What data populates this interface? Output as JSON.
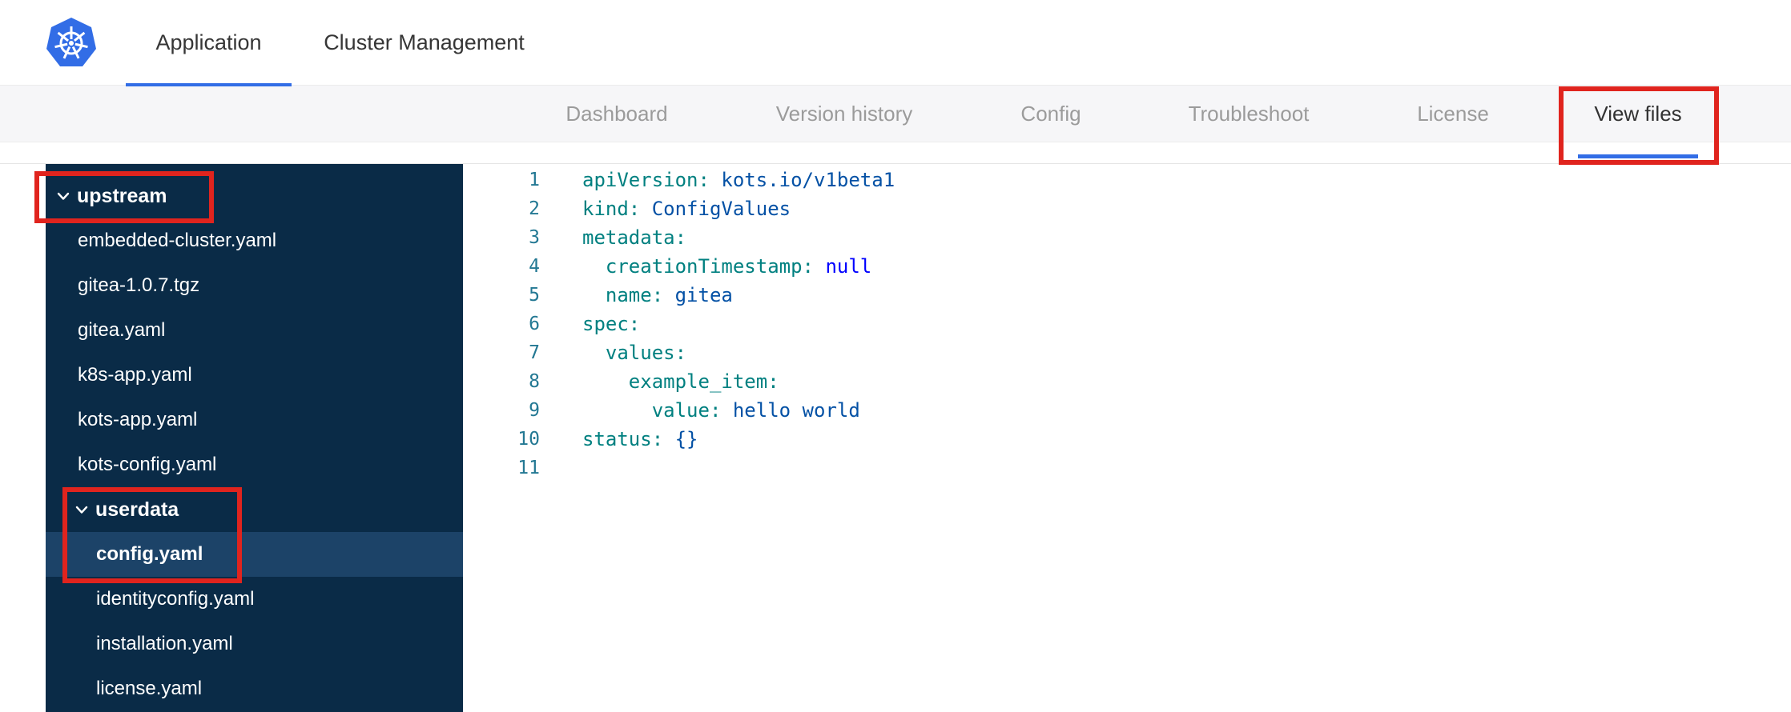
{
  "header": {
    "tabs": [
      {
        "label": "Application",
        "active": true
      },
      {
        "label": "Cluster Management",
        "active": false
      }
    ]
  },
  "subnav": {
    "tabs": [
      {
        "label": "Dashboard",
        "active": false
      },
      {
        "label": "Version history",
        "active": false
      },
      {
        "label": "Config",
        "active": false
      },
      {
        "label": "Troubleshoot",
        "active": false
      },
      {
        "label": "License",
        "active": false
      },
      {
        "label": "View files",
        "active": true
      }
    ]
  },
  "file_tree": {
    "items": [
      {
        "label": "upstream",
        "type": "folder",
        "level": 0,
        "expanded": true
      },
      {
        "label": "embedded-cluster.yaml",
        "type": "file",
        "level": 1
      },
      {
        "label": "gitea-1.0.7.tgz",
        "type": "file",
        "level": 1
      },
      {
        "label": "gitea.yaml",
        "type": "file",
        "level": 1
      },
      {
        "label": "k8s-app.yaml",
        "type": "file",
        "level": 1
      },
      {
        "label": "kots-app.yaml",
        "type": "file",
        "level": 1
      },
      {
        "label": "kots-config.yaml",
        "type": "file",
        "level": 1
      },
      {
        "label": "userdata",
        "type": "folder",
        "level": 1,
        "expanded": true
      },
      {
        "label": "config.yaml",
        "type": "file",
        "level": 2,
        "selected": true
      },
      {
        "label": "identityconfig.yaml",
        "type": "file",
        "level": 2
      },
      {
        "label": "installation.yaml",
        "type": "file",
        "level": 2
      },
      {
        "label": "license.yaml",
        "type": "file",
        "level": 2
      }
    ]
  },
  "editor": {
    "language": "yaml",
    "lines": [
      {
        "num": "1",
        "tokens": [
          {
            "c": "key",
            "t": "apiVersion:"
          },
          {
            "c": "str",
            "t": " kots.io/v1beta1"
          }
        ]
      },
      {
        "num": "2",
        "tokens": [
          {
            "c": "key",
            "t": "kind:"
          },
          {
            "c": "str",
            "t": " ConfigValues"
          }
        ]
      },
      {
        "num": "3",
        "tokens": [
          {
            "c": "key",
            "t": "metadata:"
          }
        ]
      },
      {
        "num": "4",
        "tokens": [
          {
            "c": "plain",
            "t": "  "
          },
          {
            "c": "key",
            "t": "creationTimestamp:"
          },
          {
            "c": "null",
            "t": " null"
          }
        ]
      },
      {
        "num": "5",
        "tokens": [
          {
            "c": "plain",
            "t": "  "
          },
          {
            "c": "key",
            "t": "name:"
          },
          {
            "c": "str",
            "t": " gitea"
          }
        ]
      },
      {
        "num": "6",
        "tokens": [
          {
            "c": "key",
            "t": "spec:"
          }
        ]
      },
      {
        "num": "7",
        "tokens": [
          {
            "c": "plain",
            "t": "  "
          },
          {
            "c": "key",
            "t": "values:"
          }
        ]
      },
      {
        "num": "8",
        "tokens": [
          {
            "c": "plain",
            "t": "    "
          },
          {
            "c": "key",
            "t": "example_item:"
          }
        ]
      },
      {
        "num": "9",
        "tokens": [
          {
            "c": "plain",
            "t": "      "
          },
          {
            "c": "key",
            "t": "value:"
          },
          {
            "c": "str",
            "t": " hello world"
          }
        ]
      },
      {
        "num": "10",
        "tokens": [
          {
            "c": "key",
            "t": "status:"
          },
          {
            "c": "str",
            "t": " {}"
          }
        ]
      },
      {
        "num": "11",
        "tokens": []
      }
    ]
  },
  "annotations": {
    "color": "#e0241e",
    "highlights": [
      "view-files-tab",
      "upstream-folder",
      "userdata-and-config-yaml"
    ]
  },
  "colors": {
    "accent_blue": "#326de6",
    "sidebar_bg": "#0a2b47",
    "sidebar_selected_bg": "#1c4368",
    "code_key": "#008080",
    "code_string": "#0451a5",
    "code_null": "#0000ff",
    "line_number": "#237893",
    "inactive_tab": "#9b9b9b",
    "active_tab": "#323232"
  }
}
